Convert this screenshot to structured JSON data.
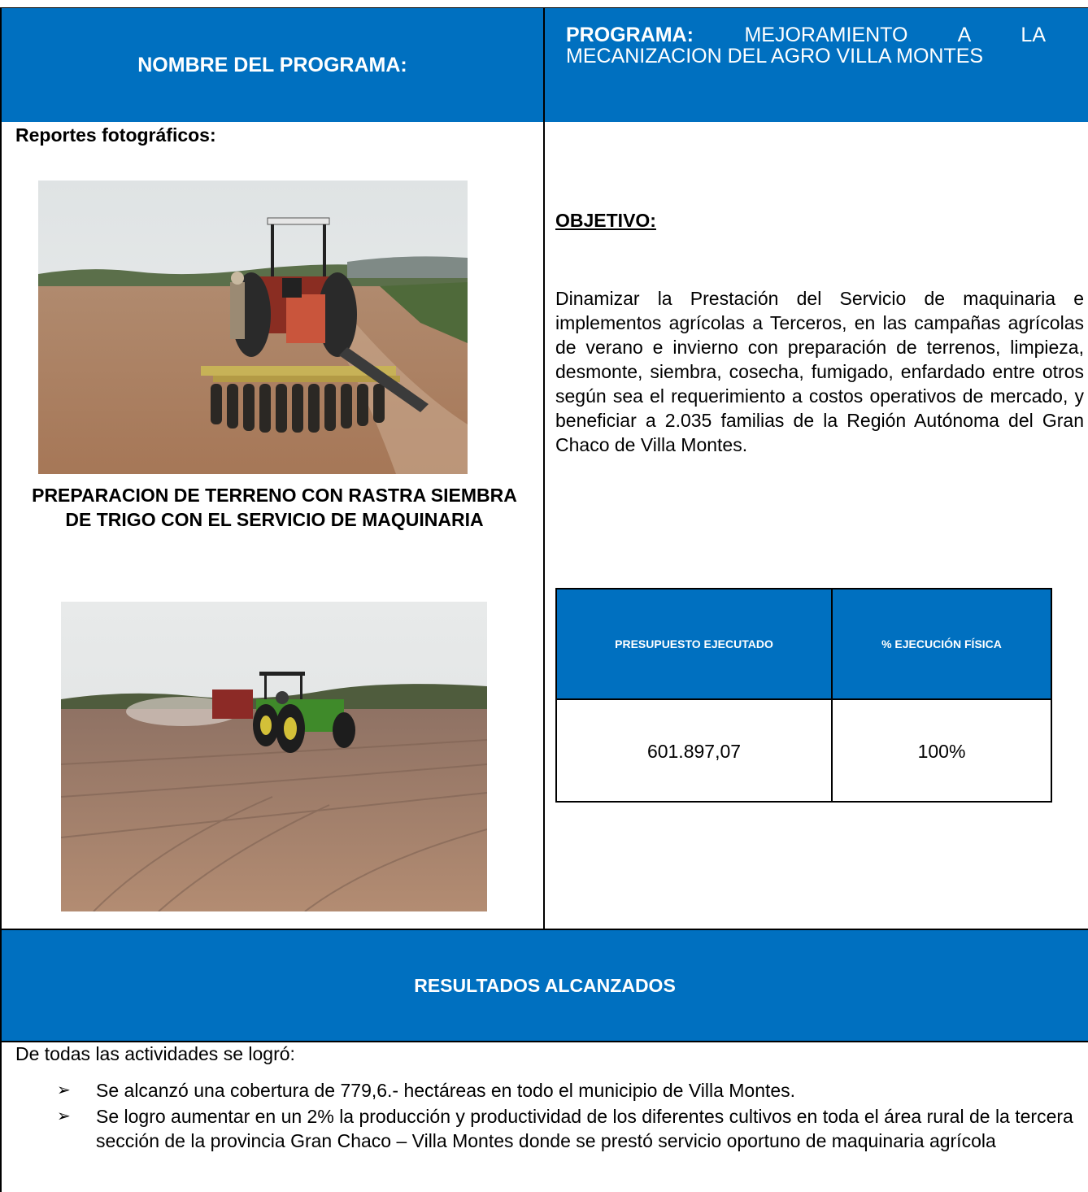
{
  "header": {
    "nombre_label": "NOMBRE DEL PROGRAMA:",
    "programa_label": "PROGRAMA:",
    "programa_value": "MEJORAMIENTO A LA MECANIZACION DEL AGRO VILLA MONTES"
  },
  "left": {
    "reportes_title": "Reportes fotográficos:",
    "caption": "PREPARACION DE TERRENO CON RASTRA SIEMBRA DE TRIGO CON EL SERVICIO DE MAQUINARIA"
  },
  "right": {
    "objetivo_title": "OBJETIVO:",
    "objetivo_text": "Dinamizar la Prestación del Servicio de maquinaria e implementos agrícolas a Terceros, en las campañas agrícolas de verano e invierno con preparación de terrenos, limpieza, desmonte, siembra, cosecha, fumigado, enfardado entre otros según sea el requerimiento a costos operativos de mercado, y beneficiar a 2.035 familias de la Región Autónoma del Gran Chaco de Villa Montes.",
    "budget_table": {
      "headers": [
        "PRESUPUESTO EJECUTADO",
        "% EJECUCIÓN FÍSICA"
      ],
      "values": [
        "601.897,07",
        "100%"
      ]
    }
  },
  "results": {
    "title": "RESULTADOS ALCANZADOS",
    "intro": "De todas las actividades se logró:",
    "items": [
      "Se alcanzó una cobertura de 779,6.- hectáreas en todo el municipio de Villa Montes.",
      "Se logro aumentar en un 2% la producción y productividad de los diferentes cultivos en toda el área rural de la tercera sección de la provincia Gran Chaco – Villa Montes donde se prestó servicio oportuno de maquinaria agrícola"
    ]
  },
  "colors": {
    "header_blue": "#0070c0",
    "text": "#000000"
  }
}
